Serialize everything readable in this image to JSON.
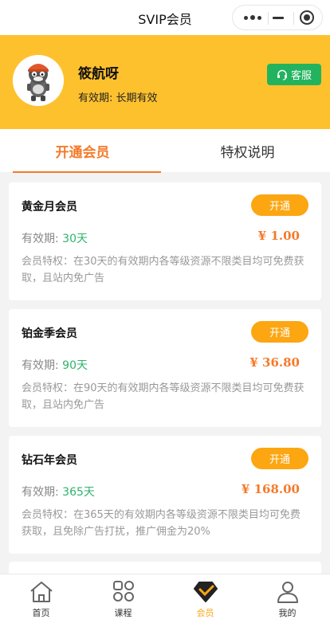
{
  "navbar": {
    "title": "SVIP会员"
  },
  "profile": {
    "username": "筱航呀",
    "validity_label": "有效期: 长期有效",
    "service_label": "客服"
  },
  "tabs": [
    {
      "label": "开通会员",
      "active": true
    },
    {
      "label": "特权说明",
      "active": false
    }
  ],
  "plans": [
    {
      "name": "黄金月会员",
      "button": "开通",
      "validity_prefix": "有效期:",
      "days": "30天",
      "price": "¥ 1.00",
      "desc": "会员特权：在30天的有效期内各等级资源不限类目均可免费获取，且站内免广告"
    },
    {
      "name": "铂金季会员",
      "button": "开通",
      "validity_prefix": "有效期:",
      "days": "90天",
      "price": "¥ 36.80",
      "desc": "会员特权：在90天的有效期内各等级资源不限类目均可免费获取，且站内免广告"
    },
    {
      "name": "钻石年会员",
      "button": "开通",
      "validity_prefix": "有效期:",
      "days": "365天",
      "price": "¥ 168.00",
      "desc": "会员特权：在365天的有效期内各等级资源不限类目均可免费获取，且免除广告打扰，推广佣金为20%"
    }
  ],
  "tabbar": [
    {
      "label": "首页",
      "icon": "home-icon",
      "active": false
    },
    {
      "label": "课程",
      "icon": "grid-icon",
      "active": false
    },
    {
      "label": "会员",
      "icon": "vip-diamond-icon",
      "active": true
    },
    {
      "label": "我的",
      "icon": "user-icon",
      "active": false
    }
  ],
  "colors": {
    "header_yellow": "#fec12e",
    "accent_orange": "#f5792a",
    "button_orange": "#fca612",
    "service_green": "#22b35e",
    "days_green": "#2fb36c"
  }
}
